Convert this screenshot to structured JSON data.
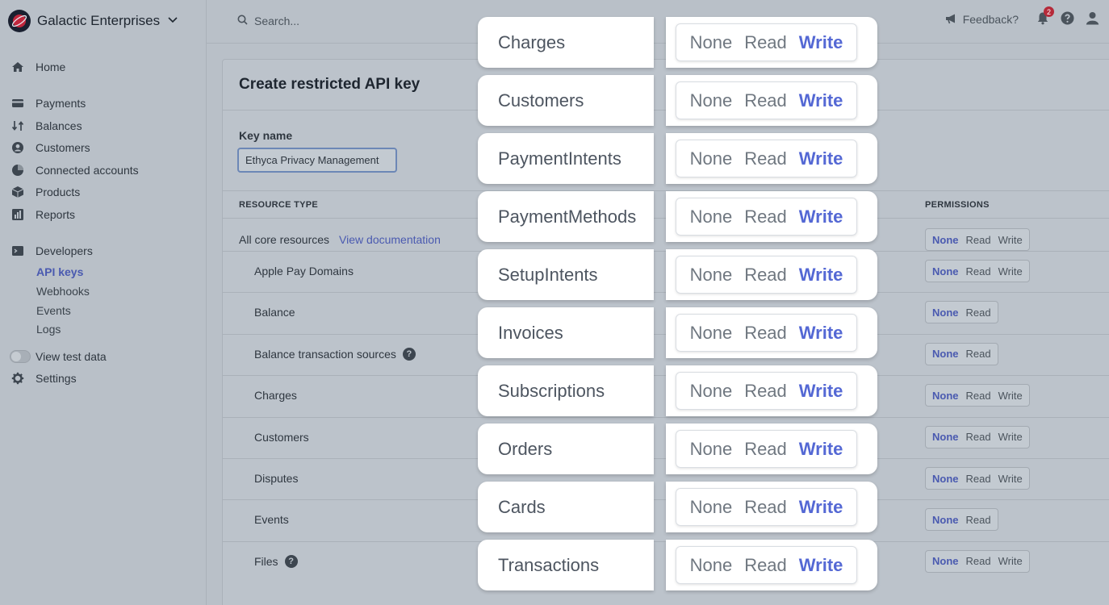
{
  "brand": {
    "name": "Galactic Enterprises"
  },
  "sidebar": {
    "items": [
      {
        "label": "Home",
        "icon": "home-icon"
      },
      {
        "label": "Payments",
        "icon": "payments-icon"
      },
      {
        "label": "Balances",
        "icon": "balances-icon"
      },
      {
        "label": "Customers",
        "icon": "customers-icon"
      },
      {
        "label": "Connected accounts",
        "icon": "connected-accounts-icon"
      },
      {
        "label": "Products",
        "icon": "products-icon"
      },
      {
        "label": "Reports",
        "icon": "reports-icon"
      },
      {
        "label": "Developers",
        "icon": "developers-icon"
      }
    ],
    "dev_sub": [
      "API keys",
      "Webhooks",
      "Events",
      "Logs"
    ],
    "test_data": "View test data",
    "settings": "Settings"
  },
  "topbar": {
    "search_placeholder": "Search...",
    "feedback": "Feedback?",
    "notification_count": "2"
  },
  "page": {
    "title": "Create restricted API key",
    "key_name_label": "Key name",
    "key_name_value": "Ethyca Privacy Management",
    "col_resource": "RESOURCE TYPE",
    "col_permissions": "PERMISSIONS",
    "core_label": "All core resources",
    "view_doc": "View documentation",
    "rows": [
      {
        "label": "Apple Pay Domains",
        "help": false,
        "perms": [
          "None",
          "Read",
          "Write"
        ]
      },
      {
        "label": "Balance",
        "help": false,
        "perms": [
          "None",
          "Read"
        ]
      },
      {
        "label": "Balance transaction sources",
        "help": true,
        "perms": [
          "None",
          "Read"
        ]
      },
      {
        "label": "Charges",
        "help": false,
        "perms": [
          "None",
          "Read",
          "Write"
        ]
      },
      {
        "label": "Customers",
        "help": false,
        "perms": [
          "None",
          "Read",
          "Write"
        ]
      },
      {
        "label": "Disputes",
        "help": false,
        "perms": [
          "None",
          "Read",
          "Write"
        ]
      },
      {
        "label": "Events",
        "help": false,
        "perms": [
          "None",
          "Read"
        ]
      },
      {
        "label": "Files",
        "help": true,
        "perms": [
          "None",
          "Read",
          "Write"
        ]
      }
    ],
    "core_perms": [
      "None",
      "Read",
      "Write"
    ]
  },
  "overlay": {
    "rows": [
      {
        "label": "Charges",
        "options": [
          "None",
          "Read",
          "Write"
        ]
      },
      {
        "label": "Customers",
        "options": [
          "None",
          "Read",
          "Write"
        ]
      },
      {
        "label": "PaymentIntents",
        "options": [
          "None",
          "Read",
          "Write"
        ]
      },
      {
        "label": "PaymentMethods",
        "options": [
          "None",
          "Read",
          "Write"
        ]
      },
      {
        "label": "SetupIntents",
        "options": [
          "None",
          "Read",
          "Write"
        ]
      },
      {
        "label": "Invoices",
        "options": [
          "None",
          "Read",
          "Write"
        ]
      },
      {
        "label": "Subscriptions",
        "options": [
          "None",
          "Read",
          "Write"
        ]
      },
      {
        "label": "Orders",
        "options": [
          "None",
          "Read",
          "Write"
        ]
      },
      {
        "label": "Cards",
        "options": [
          "None",
          "Read",
          "Write"
        ]
      },
      {
        "label": "Transactions",
        "options": [
          "None",
          "Read",
          "Write"
        ]
      }
    ],
    "selected": "Write"
  },
  "colors": {
    "accent": "#5468d4",
    "link": "#4a5ab0",
    "badge": "#b52a3a"
  }
}
